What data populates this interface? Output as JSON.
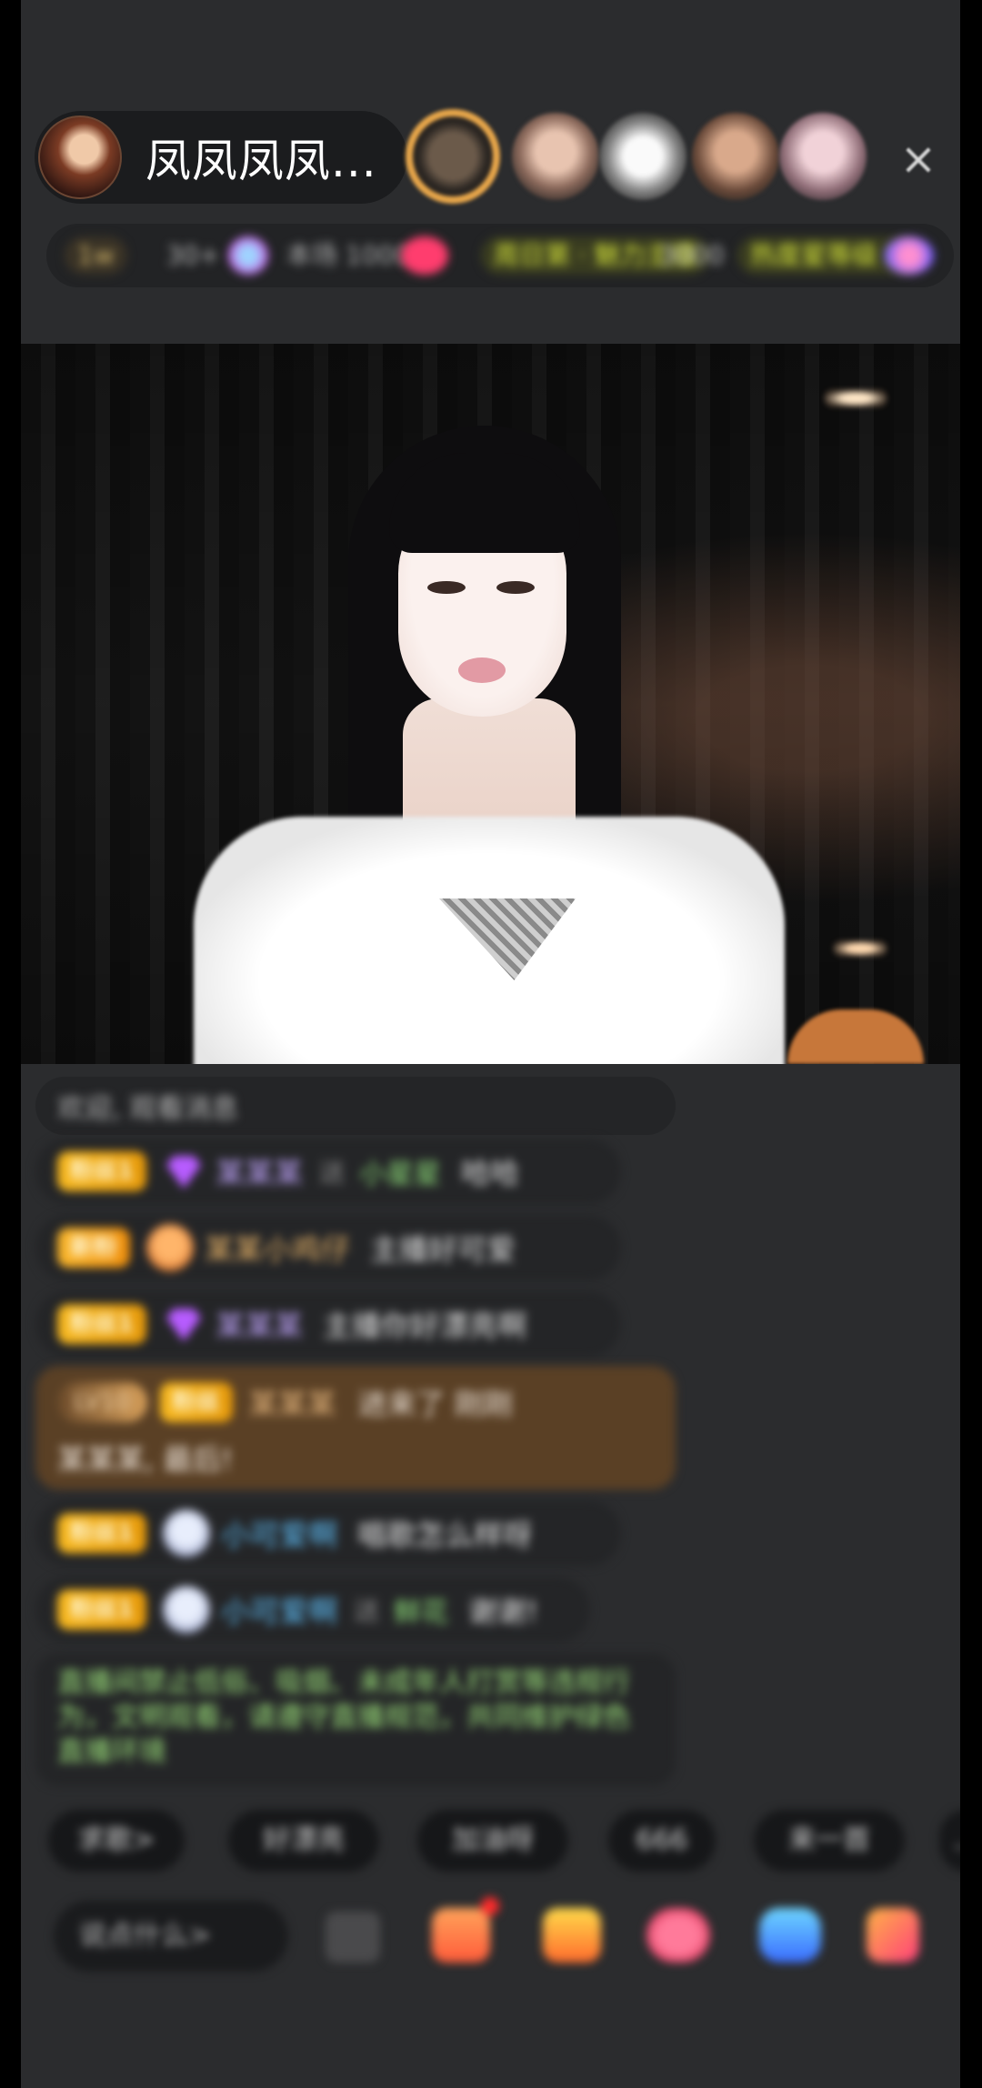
{
  "header": {
    "host_name": "凤凤凤凤...",
    "close_icon": "×"
  },
  "info_bar": {
    "coin": "1w",
    "rank": "30+",
    "fans": "本场 1000",
    "tag1": "周日第 · 魅力主播",
    "tag2": "3000",
    "tag3": "热度星等级",
    "tag3_suffix": ">"
  },
  "comments": {
    "system": "欢迎, 观看消息",
    "rows": [
      {
        "badge": "粉丝1",
        "name": "某某某",
        "sep": "送",
        "extra": "小星星",
        "text": "哈哈"
      },
      {
        "badge": "新粉",
        "name": "某某小鸡仔",
        "sep": "",
        "extra": "",
        "text": "主播好可爱"
      },
      {
        "badge": "粉丝1",
        "name": "某某某",
        "sep": "",
        "extra": "",
        "text": "主播你好漂亮啊"
      }
    ],
    "big_row": {
      "level": "LV10",
      "badge": "粉丝",
      "name": "某某某",
      "text": "进来了 刚刚",
      "line2": "某某某, 最后!"
    },
    "rows2": [
      {
        "badge": "粉丝1",
        "name": "小可爱啊",
        "text": "唱歌怎么样呀"
      },
      {
        "badge": "粉丝1",
        "name": "小可爱啊",
        "sep": "送",
        "extra": "鲜花",
        "text": "谢谢!"
      }
    ],
    "notice": "直播间禁止低俗、吸烟、未成年人打赏等违规行为，文明观看，请遵守直播规范，共同维护绿色直播环境"
  },
  "chips": [
    "求歌>",
    "好漂亮",
    "加油呀",
    "666",
    "来一首",
    "..."
  ],
  "bottom": {
    "input_placeholder": "说点什么>"
  }
}
